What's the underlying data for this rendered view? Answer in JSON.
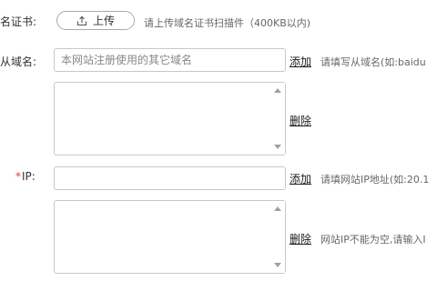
{
  "certificate": {
    "label": "名证书:",
    "upload_label": "上传",
    "hint": "请上传域名证书扫描件（400KB以内)"
  },
  "secondary_domain": {
    "label": "从域名:",
    "placeholder": "本网站注册使用的其它域名",
    "add_label": "添加",
    "hint": "请填写从域名(如:baidu",
    "delete_label": "删除"
  },
  "ip": {
    "required_mark": "*",
    "label": "IP:",
    "add_label": "添加",
    "hint": "请填网站IP地址(如:20.1",
    "delete_label": "删除",
    "delete_hint": "网站IP不能为空,请输入I"
  },
  "colors": {
    "required": "#e4393c",
    "border": "#c8c8c8",
    "hint_text": "#666666"
  }
}
